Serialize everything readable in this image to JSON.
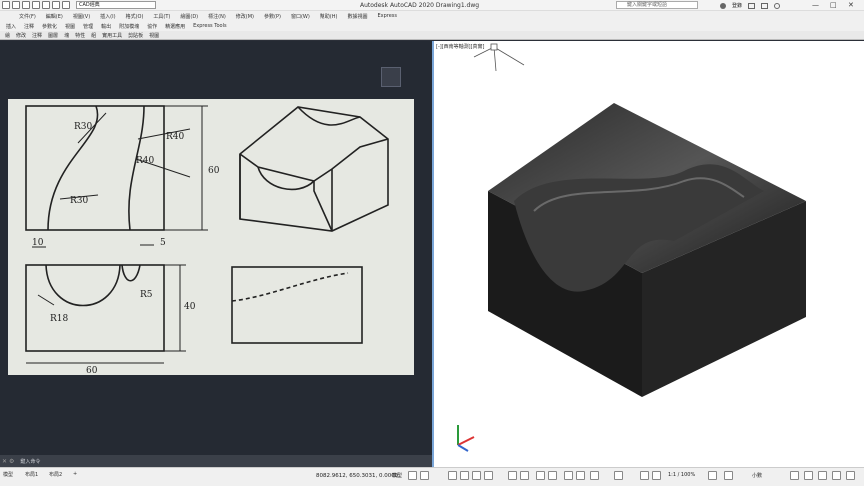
{
  "title_bar": {
    "workspace": "CAD經典",
    "app_title": "Autodesk AutoCAD 2020   Drawing1.dwg",
    "search_placeholder": "鍵入關鍵字或短語",
    "login": "登錄"
  },
  "menu": [
    "文件(F)",
    "編輯(E)",
    "視圖(V)",
    "插入(I)",
    "格式(O)",
    "工具(T)",
    "繪圖(D)",
    "標注(N)",
    "修改(M)",
    "參數(P)",
    "窗口(W)",
    "幫助(H)",
    "數據視圖",
    "Express"
  ],
  "toolbar_row": [
    "插入",
    "注釋",
    "參數化",
    "視圖",
    "管理",
    "輸出",
    "附加模塊",
    "協作",
    "精選應用",
    "Express Tools"
  ],
  "ribbon_row": [
    "繪",
    "修改",
    "注釋",
    "圖層",
    "塊",
    "特性",
    "組",
    "實用工具",
    "剪貼板",
    "視圖"
  ],
  "viewport": {
    "label": "[-][西南等軸測][真實]"
  },
  "drawing": {
    "dims": {
      "r30_top": "R30",
      "r40_a": "R40",
      "r40_b": "R40",
      "r30_bottom": "R30",
      "h60": "60",
      "w10": "10",
      "w5": "5",
      "r18": "R18",
      "r5": "R5",
      "h40": "40",
      "w60": "60"
    }
  },
  "command": {
    "prompt": "鍵入命令"
  },
  "status": {
    "tab_model": "模型",
    "tab_layout1": "布局1",
    "tab_layout2": "布局2",
    "coords": "8082.9612, 650.3031, 0.0000",
    "model_label": "模型",
    "scale": "1:1 / 100%",
    "units": "小數"
  }
}
